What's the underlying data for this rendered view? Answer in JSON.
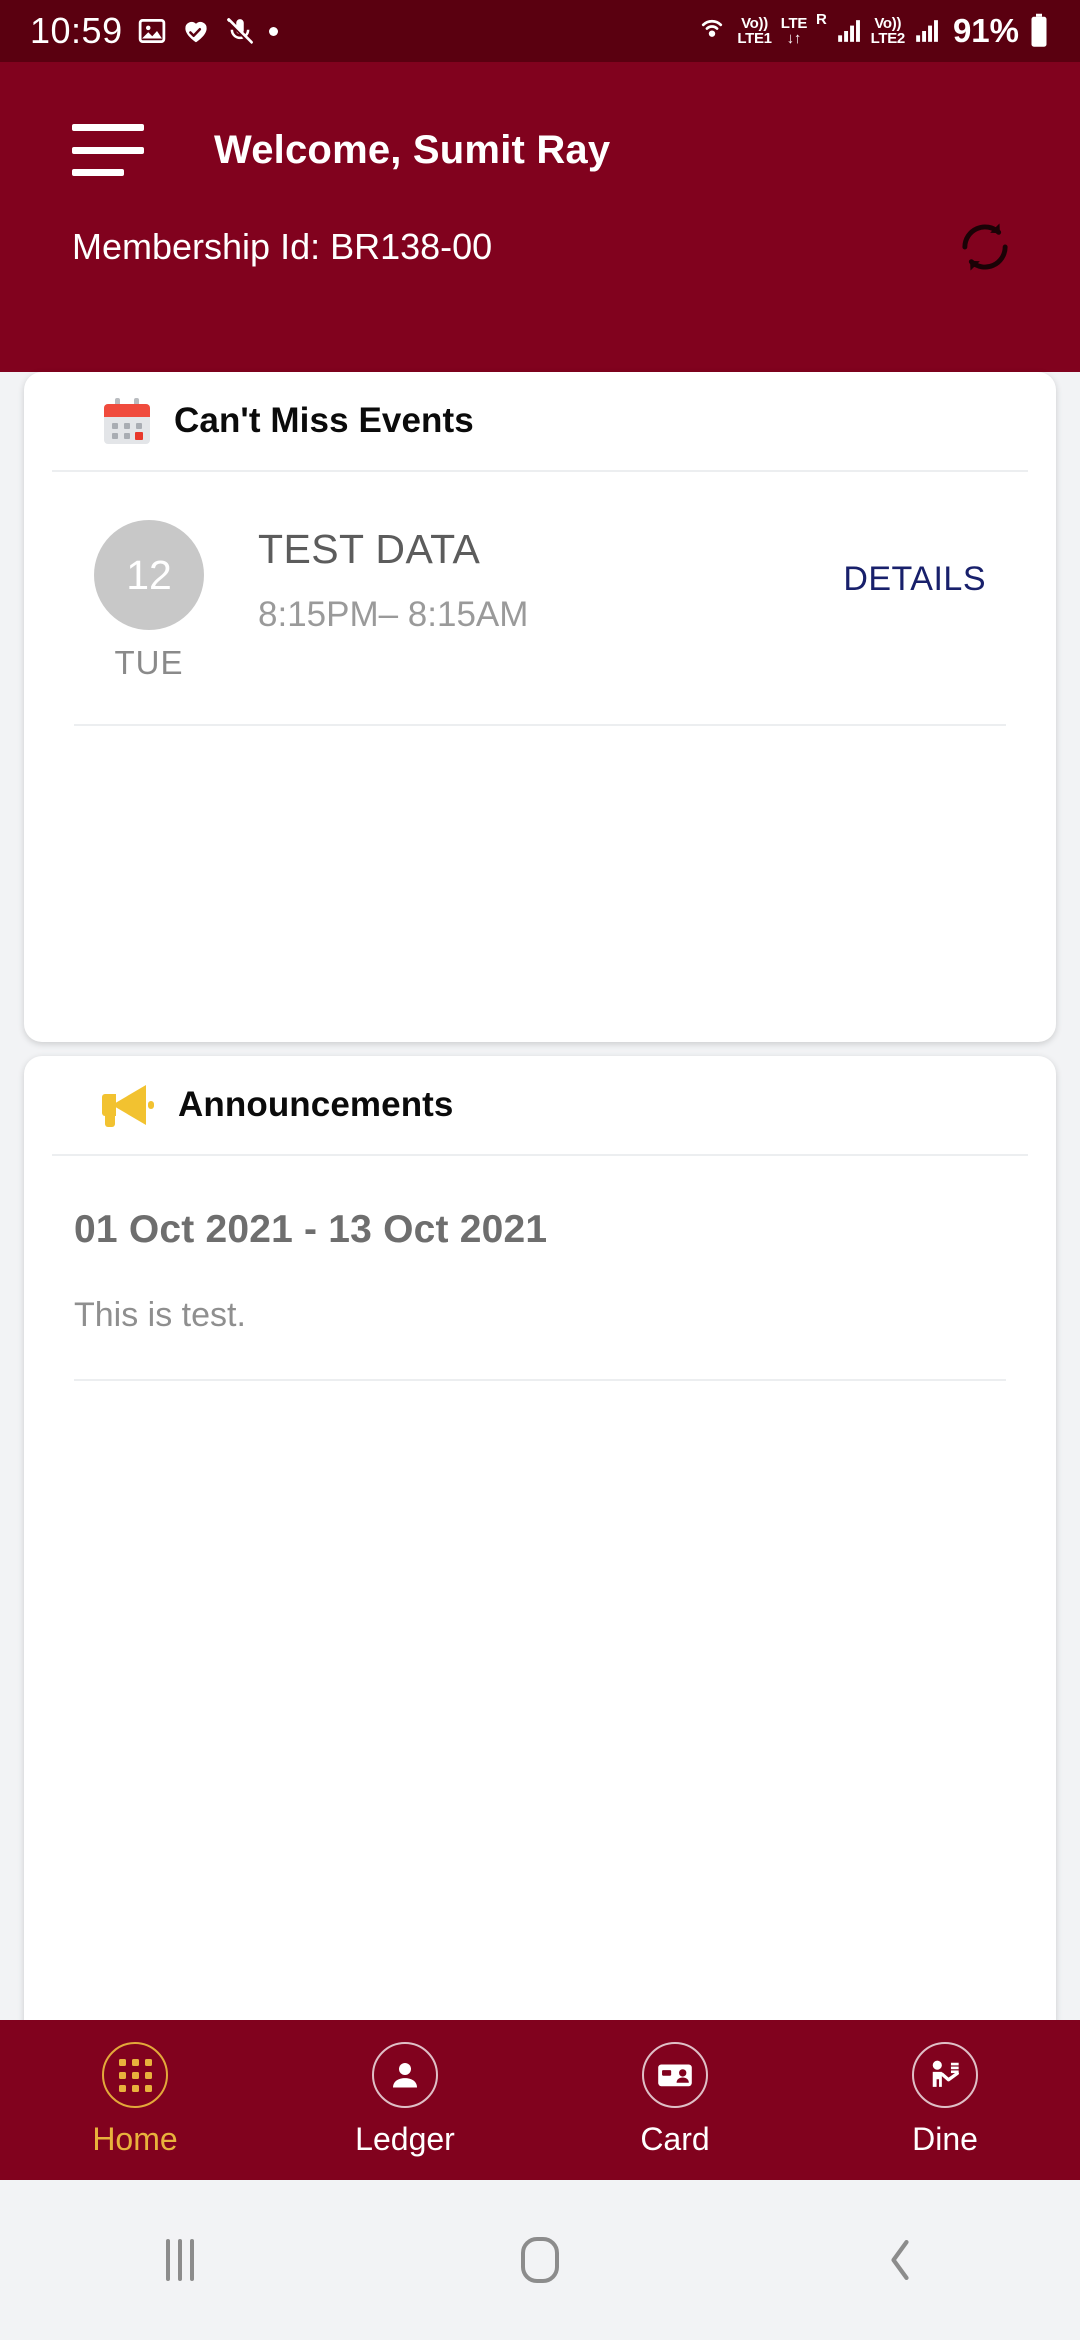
{
  "status_bar": {
    "time": "10:59",
    "battery_percent": "91%",
    "network": {
      "sim1_volte": "Vo))",
      "sim1_label": "LTE1",
      "lte_label": "LTE",
      "roaming": "R",
      "sim2_volte": "Vo))",
      "sim2_label": "LTE2"
    },
    "icons": [
      "image-icon",
      "heart-health-icon",
      "mic-muted-icon",
      "dot-icon",
      "hotspot-icon",
      "signal-bars-icon",
      "battery-icon"
    ]
  },
  "header": {
    "menu_icon": "hamburger-menu-icon",
    "welcome_title": "Welcome, Sumit  Ray",
    "membership_label": "Membership Id: BR138-00",
    "refresh_icon": "refresh-icon"
  },
  "events_card": {
    "icon": "calendar-icon",
    "title": "Can't Miss Events",
    "rows": [
      {
        "day_number": "12",
        "day_name": "TUE",
        "title": "TEST DATA",
        "time": "8:15PM– 8:15AM",
        "action_label": "DETAILS"
      }
    ]
  },
  "announcements_card": {
    "icon": "megaphone-icon",
    "title": "Announcements",
    "items": [
      {
        "date_range": "01 Oct 2021 - 13 Oct 2021",
        "body": "This is test."
      }
    ]
  },
  "bottom_nav": {
    "items": [
      {
        "label": "Home",
        "icon": "grid-dots-icon",
        "active": true
      },
      {
        "label": "Ledger",
        "icon": "person-icon",
        "active": false
      },
      {
        "label": "Card",
        "icon": "id-card-icon",
        "active": false
      },
      {
        "label": "Dine",
        "icon": "waiter-icon",
        "active": false
      }
    ]
  },
  "android_nav": {
    "recents_label": "recents-icon",
    "home_label": "home-icon",
    "back_label": "back-icon"
  },
  "colors": {
    "status_bar_bg": "#5a0010",
    "brand_maroon": "#81021e",
    "page_bg": "#f2f3f5",
    "card_bg": "#ffffff",
    "accent_gold": "#e8b23c",
    "link_navy": "#18206b"
  }
}
